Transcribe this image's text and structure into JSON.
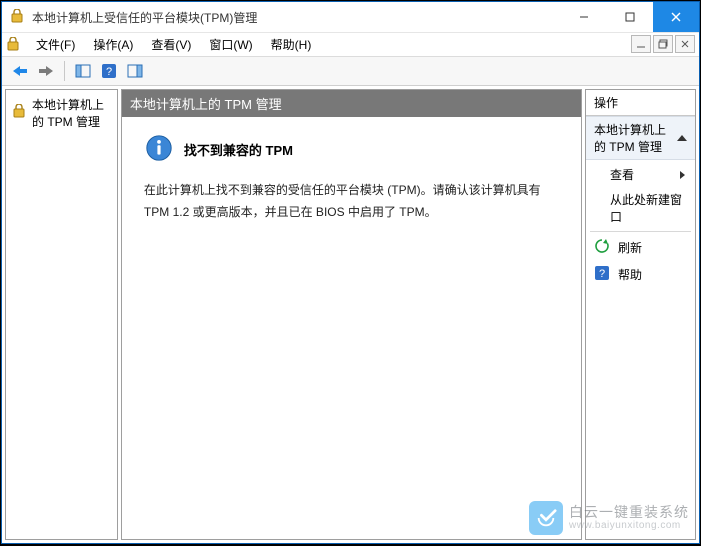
{
  "window": {
    "title": "本地计算机上受信任的平台模块(TPM)管理"
  },
  "menu": {
    "file": "文件(F)",
    "action": "操作(A)",
    "view": "查看(V)",
    "window": "窗口(W)",
    "help": "帮助(H)"
  },
  "tree": {
    "root": "本地计算机上的 TPM 管理"
  },
  "center": {
    "header": "本地计算机上的 TPM 管理",
    "info_title": "找不到兼容的 TPM",
    "info_text": "在此计算机上找不到兼容的受信任的平台模块 (TPM)。请确认该计算机具有 TPM 1.2 或更高版本，并且已在 BIOS 中启用了 TPM。"
  },
  "actions": {
    "header": "操作",
    "section": "本地计算机上的 TPM 管理",
    "view": "查看",
    "new_window": "从此处新建窗口",
    "refresh": "刷新",
    "help": "帮助"
  },
  "watermark": {
    "line1": "白云一键重装系统",
    "line2": "www.baiyunxitong.com"
  }
}
